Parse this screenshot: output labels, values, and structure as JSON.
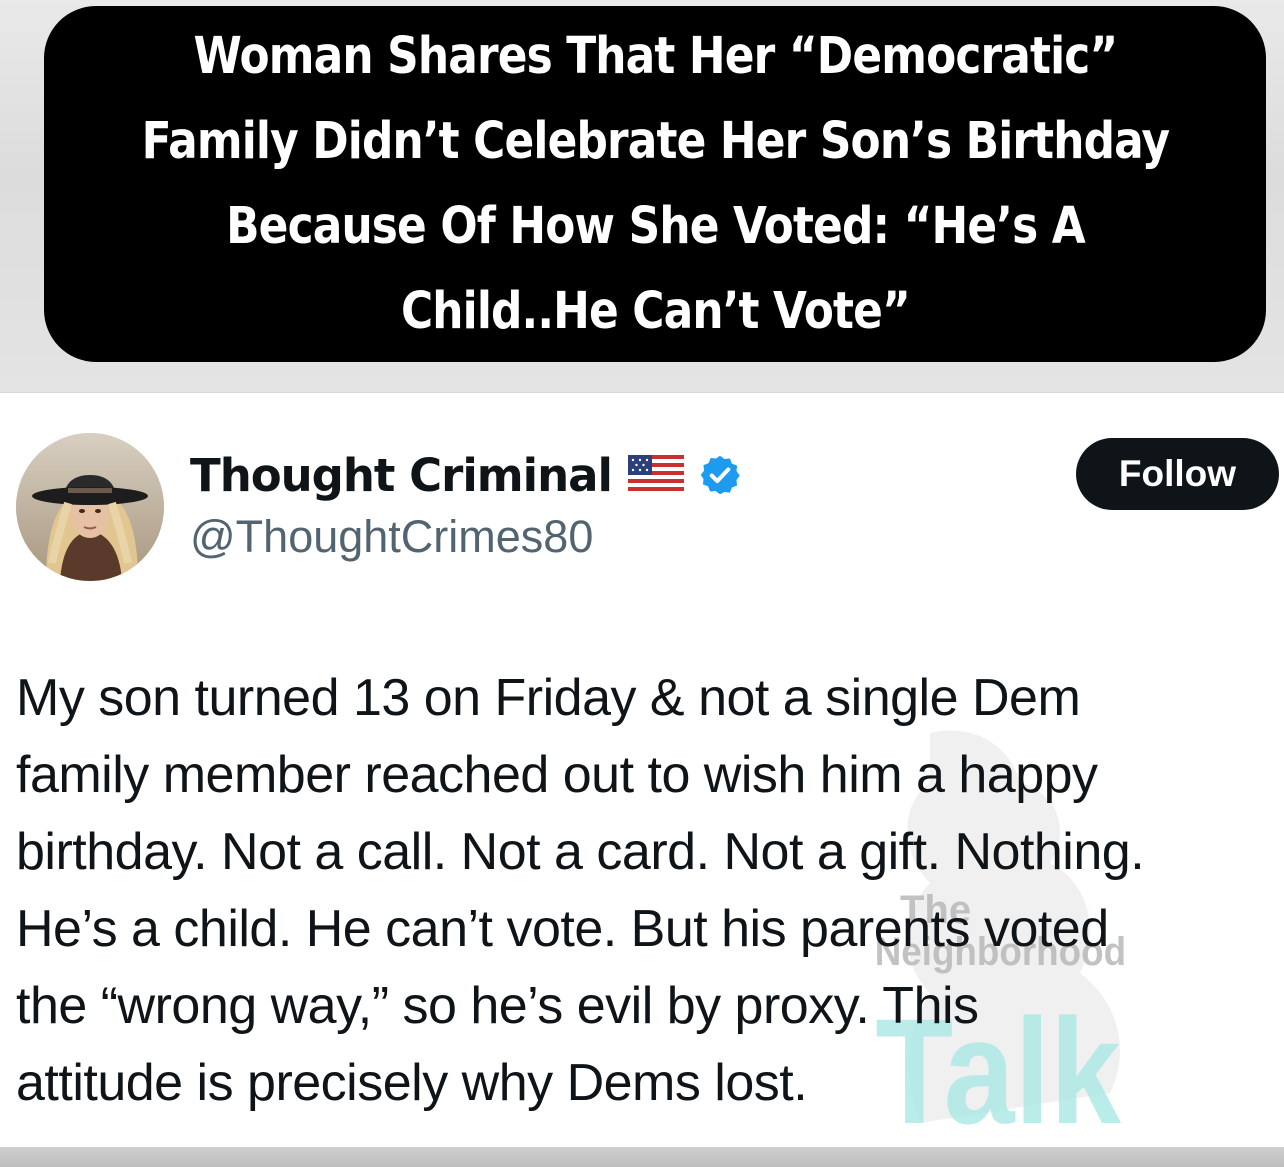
{
  "headline": {
    "lines": [
      "Woman Shares That Her “Democratic”",
      "Family Didn’t Celebrate Her Son’s Birthday",
      "Because Of How She Voted: “He’s A",
      "Child..He Can’t Vote”"
    ]
  },
  "tweet": {
    "author": {
      "display_name": "Thought Criminal",
      "handle": "@ThoughtCrimes80",
      "avatar_icon": "profile-photo",
      "badges": [
        "us-flag-icon",
        "verified-icon"
      ]
    },
    "follow_label": "Follow",
    "body_lines": [
      "My son turned 13 on Friday & not a single Dem",
      "family member reached out to wish him a happy",
      "birthday. Not a call. Not a card. Not a gift. Nothing.",
      "He’s a child. He can’t vote. But his parents voted",
      "the “wrong way,” so he’s evil by proxy. This",
      "attitude is precisely why Dems lost."
    ]
  },
  "watermark": {
    "lines": [
      "The",
      "Neighborhood",
      "Talk"
    ]
  },
  "colors": {
    "headline_bg": "#000000",
    "headline_text": "#ffffff",
    "follow_bg": "#0f1419",
    "verified": "#1d9bf0",
    "handle": "#536471",
    "watermark_accent": "#aee9e6"
  }
}
